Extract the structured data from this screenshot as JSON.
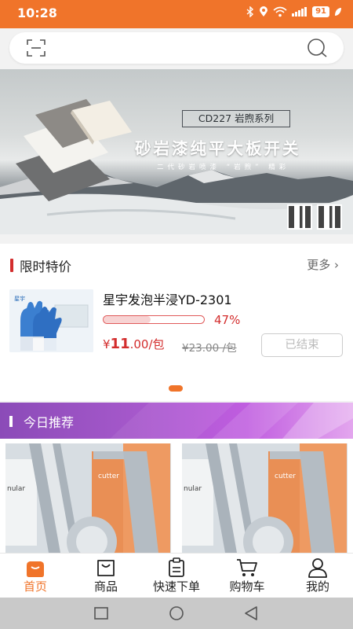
{
  "status_bar": {
    "time": "10:28",
    "battery": "91"
  },
  "search": {
    "scan_icon": "scan-icon",
    "search_icon": "search-icon"
  },
  "banner": {
    "tag": "CD227 岩煦系列",
    "title": "砂岩漆纯平大板开关",
    "subtitle": "二代砂岩喷漆 “岩煦” 精彩"
  },
  "flash_sale": {
    "title": "限时特价",
    "more": "更多 ›",
    "product": {
      "name": "星宇发泡半浸YD-2301",
      "sold_percent": 47,
      "sold_text": "47%",
      "price_symbol": "¥",
      "price_int": "11",
      "price_dec": ".00",
      "price_unit": "/包",
      "original_price": "¥23.00 /包",
      "status_button": "已结束"
    }
  },
  "recommend": {
    "title": "今日推荐"
  },
  "tabbar": {
    "items": [
      {
        "label": "首页",
        "icon": "home-icon",
        "active": true
      },
      {
        "label": "商品",
        "icon": "bag-icon",
        "active": false
      },
      {
        "label": "快速下单",
        "icon": "clipboard-icon",
        "active": false
      },
      {
        "label": "购物车",
        "icon": "cart-icon",
        "active": false
      },
      {
        "label": "我的",
        "icon": "user-icon",
        "active": false
      }
    ]
  },
  "colors": {
    "accent": "#f0742a",
    "price_red": "#d32d2d",
    "recommend_purple": "#a357c9"
  }
}
